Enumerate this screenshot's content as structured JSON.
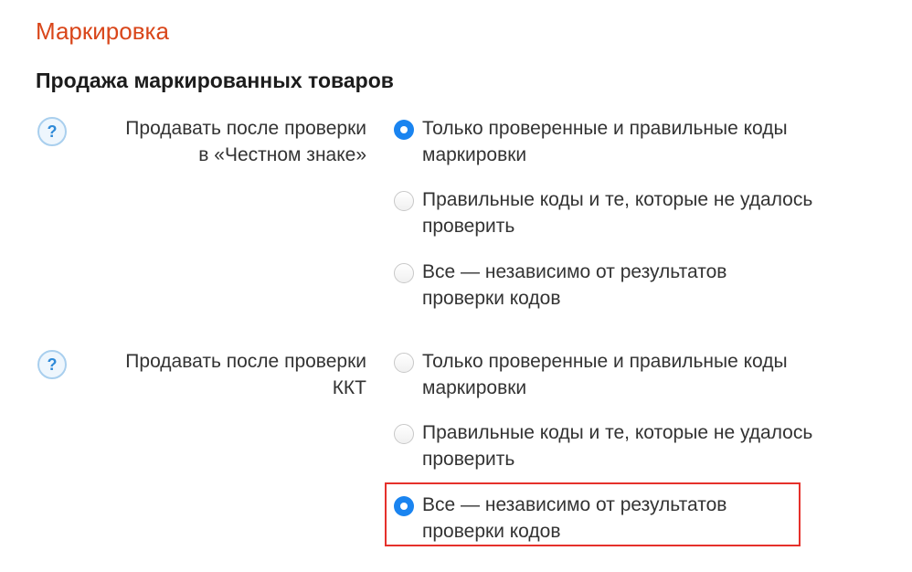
{
  "page": {
    "title": "Маркировка",
    "section_title": "Продажа маркированных товаров"
  },
  "settings": [
    {
      "help_icon": "question-icon",
      "help_glyph": "?",
      "label_line1": "Продавать после проверки",
      "label_line2": "в «Честном знаке»",
      "options": [
        {
          "line1": "Только проверенные и правильные коды",
          "line2": "маркировки",
          "checked": true
        },
        {
          "line1": "Правильные коды и те, которые не удалось",
          "line2": "проверить",
          "checked": false
        },
        {
          "line1": "Все — независимо от результатов",
          "line2": "проверки кодов",
          "checked": false
        }
      ]
    },
    {
      "help_icon": "question-icon",
      "help_glyph": "?",
      "label_line1": "Продавать после проверки",
      "label_line2": "ККТ",
      "options": [
        {
          "line1": "Только проверенные и правильные коды",
          "line2": "маркировки",
          "checked": false
        },
        {
          "line1": "Правильные коды и те, которые не удалось",
          "line2": "проверить",
          "checked": false
        },
        {
          "line1": "Все — независимо от результатов",
          "line2": "проверки кодов",
          "checked": true
        }
      ]
    }
  ],
  "colors": {
    "title": "#d9461a",
    "radio_checked": "#1a84f0",
    "highlight_border": "#e5312b",
    "help_icon": "#2f8ad8"
  }
}
